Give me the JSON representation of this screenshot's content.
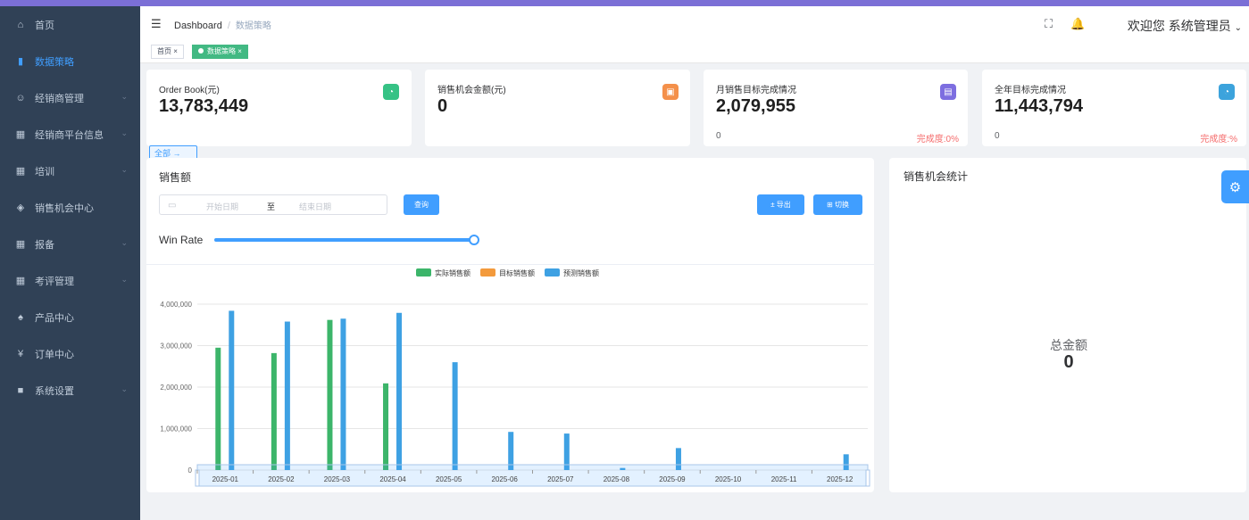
{
  "sidebar": {
    "items": [
      {
        "label": "首页",
        "icon": "dashboard-icon",
        "glyph": "⌂",
        "active": false,
        "arrow": false
      },
      {
        "label": "数据策略",
        "icon": "chart-icon",
        "glyph": "▮",
        "active": true,
        "arrow": false
      },
      {
        "label": "经销商管理",
        "icon": "users-icon",
        "glyph": "☺",
        "active": false,
        "arrow": true
      },
      {
        "label": "经销商平台信息",
        "icon": "grid-icon",
        "glyph": "▦",
        "active": false,
        "arrow": true
      },
      {
        "label": "培训",
        "icon": "grid-icon",
        "glyph": "▦",
        "active": false,
        "arrow": true
      },
      {
        "label": "销售机会中心",
        "icon": "compass-icon",
        "glyph": "◈",
        "active": false,
        "arrow": false
      },
      {
        "label": "报备",
        "icon": "grid-icon",
        "glyph": "▦",
        "active": false,
        "arrow": true
      },
      {
        "label": "考评管理",
        "icon": "grid-icon",
        "glyph": "▦",
        "active": false,
        "arrow": true
      },
      {
        "label": "产品中心",
        "icon": "shirt-icon",
        "glyph": "♠",
        "active": false,
        "arrow": false
      },
      {
        "label": "订单中心",
        "icon": "yen-icon",
        "glyph": "¥",
        "active": false,
        "arrow": false
      },
      {
        "label": "系统设置",
        "icon": "settings-box-icon",
        "glyph": "■",
        "active": false,
        "arrow": true
      }
    ]
  },
  "header": {
    "breadcrumb_root": "Dashboard",
    "breadcrumb_separator": "/",
    "breadcrumb_current": "数据策略",
    "welcome": "欢迎您 系统管理员",
    "dropdown_caret": "⌄"
  },
  "tags": {
    "home": "首页",
    "current": "数据策略",
    "close": "×"
  },
  "stats": [
    {
      "title": "Order Book(元)",
      "value": "13,783,449",
      "icon": "pie-icon",
      "color": "#36c285"
    },
    {
      "title": "销售机会金额(元)",
      "value": "0",
      "icon": "briefcase-icon",
      "color": "#f4904a"
    },
    {
      "title": "月销售目标完成情况",
      "value": "2,079,955",
      "icon": "clipboard-icon",
      "color": "#7d6ee0",
      "foot_left": "0",
      "foot_right": "完成度:0%"
    },
    {
      "title": "全年目标完成情况",
      "value": "11,443,794",
      "icon": "pie-icon",
      "color": "#3ca3dc",
      "foot_left": "0",
      "foot_right": "完成度:%"
    }
  ],
  "all_button": "全部 →",
  "sales_panel": {
    "title": "销售额",
    "start_placeholder": "开始日期",
    "range_separator": "至",
    "end_placeholder": "结束日期",
    "query_button": "查询",
    "export_button": "± 导出",
    "switch_button": "⊞ 切换",
    "win_rate_label": "Win Rate",
    "win_rate_value": 1.0
  },
  "opportunity_panel": {
    "title": "销售机会统计",
    "total_label": "总金额",
    "total_value": "0"
  },
  "colors": {
    "actual": "#3cb56a",
    "target": "#f39a3c",
    "forecast": "#3ea1e3",
    "sidebar_bg": "#304156",
    "accent": "#409eff"
  },
  "chart_data": {
    "type": "bar",
    "categories": [
      "2025-01",
      "2025-02",
      "2025-03",
      "2025-04",
      "2025-05",
      "2025-06",
      "2025-07",
      "2025-08",
      "2025-09",
      "2025-10",
      "2025-11",
      "2025-12"
    ],
    "series": [
      {
        "name": "实际销售额",
        "values": [
          2950000,
          2820000,
          3620000,
          2090000,
          0,
          0,
          0,
          0,
          0,
          0,
          0,
          0
        ]
      },
      {
        "name": "目标销售额",
        "values": [
          0,
          0,
          0,
          0,
          0,
          0,
          0,
          0,
          0,
          0,
          0,
          0
        ]
      },
      {
        "name": "预测销售额",
        "values": [
          3840000,
          3580000,
          3650000,
          3790000,
          2600000,
          920000,
          880000,
          50000,
          530000,
          0,
          0,
          380000
        ]
      }
    ],
    "yticks": [
      "0",
      "1,000,000",
      "2,000,000",
      "3,000,000",
      "4,000,000"
    ],
    "ylim": [
      0,
      4000000
    ],
    "legend_position": "top",
    "grid": true
  }
}
